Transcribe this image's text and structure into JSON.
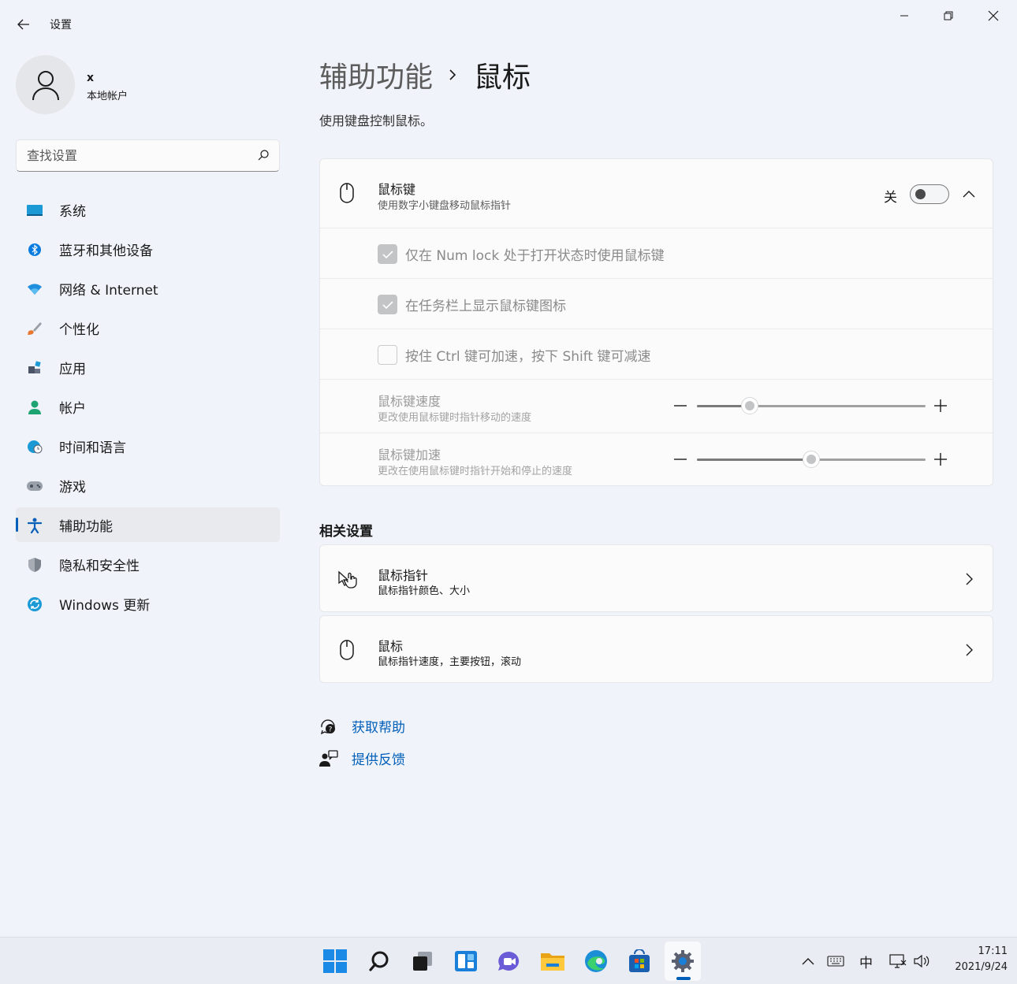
{
  "window": {
    "title": "设置"
  },
  "user": {
    "name": "x",
    "account_type": "本地帐户"
  },
  "search": {
    "placeholder": "查找设置"
  },
  "sidebar": {
    "items": [
      {
        "label": "系统",
        "icon": "system-icon"
      },
      {
        "label": "蓝牙和其他设备",
        "icon": "bluetooth-icon"
      },
      {
        "label": "网络 & Internet",
        "icon": "wifi-icon"
      },
      {
        "label": "个性化",
        "icon": "brush-icon"
      },
      {
        "label": "应用",
        "icon": "apps-icon"
      },
      {
        "label": "帐户",
        "icon": "account-icon"
      },
      {
        "label": "时间和语言",
        "icon": "globe-clock-icon"
      },
      {
        "label": "游戏",
        "icon": "gamepad-icon"
      },
      {
        "label": "辅助功能",
        "icon": "accessibility-icon",
        "active": true
      },
      {
        "label": "隐私和安全性",
        "icon": "shield-icon"
      },
      {
        "label": "Windows 更新",
        "icon": "update-icon"
      }
    ]
  },
  "breadcrumb": {
    "parent": "辅助功能",
    "current": "鼠标"
  },
  "page": {
    "description": "使用键盘控制鼠标。"
  },
  "mouse_keys": {
    "title": "鼠标键",
    "subtitle": "使用数字小键盘移动鼠标指针",
    "toggle_label": "关",
    "toggle_on": false,
    "options": [
      {
        "label": "仅在 Num lock 处于打开状态时使用鼠标键",
        "checked": true
      },
      {
        "label": "在任务栏上显示鼠标键图标",
        "checked": true
      },
      {
        "label": "按住 Ctrl 键可加速，按下 Shift 键可减速",
        "checked": false
      }
    ],
    "speed": {
      "title": "鼠标键速度",
      "subtitle": "更改使用鼠标键时指针移动的速度",
      "value_percent": 23
    },
    "acceleration": {
      "title": "鼠标键加速",
      "subtitle": "更改在使用鼠标键时指针开始和停止的速度",
      "value_percent": 50
    }
  },
  "related": {
    "title": "相关设置",
    "items": [
      {
        "title": "鼠标指针",
        "subtitle": "鼠标指针颜色、大小",
        "icon": "mouse-pointer-icon"
      },
      {
        "title": "鼠标",
        "subtitle": "鼠标指针速度，主要按钮，滚动",
        "icon": "mouse-icon"
      }
    ]
  },
  "help": {
    "get_help": "获取帮助",
    "feedback": "提供反馈"
  },
  "taskbar": {
    "ime": "中",
    "time": "17:11",
    "date": "2021/9/24"
  },
  "colors": {
    "accent": "#005fb8",
    "background": "#f0f3f9",
    "card": "#fbfbfc"
  }
}
